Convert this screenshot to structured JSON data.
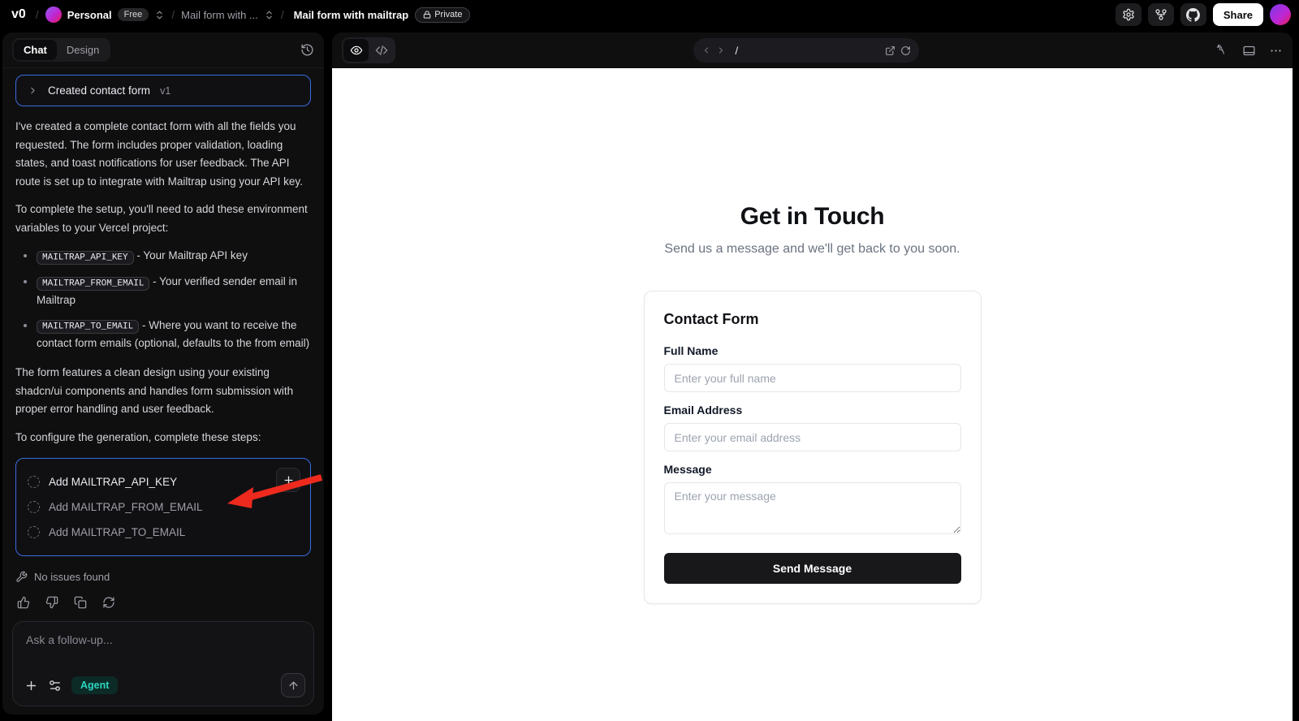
{
  "topbar": {
    "logo": "v0",
    "separator": "/",
    "team": {
      "name": "Personal",
      "plan_badge": "Free"
    },
    "breadcrumb_project": "Mail form with ...",
    "title": "Mail form with mailtrap",
    "privacy_badge": "Private",
    "share_label": "Share"
  },
  "chat": {
    "tabs": {
      "chat": "Chat",
      "design": "Design"
    },
    "version_card": {
      "title": "Created contact form",
      "version": "v1"
    },
    "message": {
      "p1": "I've created a complete contact form with all the fields you requested. The form includes proper validation, loading states, and toast notifications for user feedback. The API route is set up to integrate with Mailtrap using your API key.",
      "p2": "To complete the setup, you'll need to add these environment variables to your Vercel project:",
      "p3": "The form features a clean design using your existing shadcn/ui components and handles form submission with proper error handling and user feedback.",
      "p4": "To configure the generation, complete these steps:"
    },
    "env_vars": [
      {
        "code": "MAILTRAP_API_KEY",
        "description": " - Your Mailtrap API key"
      },
      {
        "code": "MAILTRAP_FROM_EMAIL",
        "description": " - Your verified sender email in Mailtrap"
      },
      {
        "code": "MAILTRAP_TO_EMAIL",
        "description": " - Where you want to receive the contact form emails (optional, defaults to the from email)"
      }
    ],
    "tasks": [
      {
        "label": "Add MAILTRAP_API_KEY"
      },
      {
        "label": "Add MAILTRAP_FROM_EMAIL"
      },
      {
        "label": "Add MAILTRAP_TO_EMAIL"
      }
    ],
    "issues_status": "No issues found",
    "composer": {
      "placeholder": "Ask a follow-up...",
      "agent_label": "Agent"
    }
  },
  "preview": {
    "url_path": "/",
    "page": {
      "heading": "Get in Touch",
      "subheading": "Send us a message and we'll get back to you soon.",
      "form": {
        "title": "Contact Form",
        "fields": [
          {
            "label": "Full Name",
            "placeholder": "Enter your full name"
          },
          {
            "label": "Email Address",
            "placeholder": "Enter your email address"
          },
          {
            "label": "Message",
            "placeholder": "Enter your message"
          }
        ],
        "submit_label": "Send Message"
      }
    }
  },
  "colors": {
    "accent_blue": "#3b6ce0",
    "agent_teal": "#2dd4bf",
    "arrow_red": "#ee2a1e",
    "button_dark": "#18181b"
  }
}
